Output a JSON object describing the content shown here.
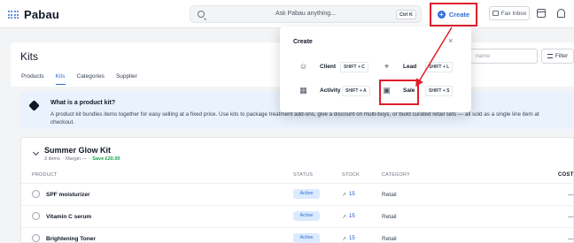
{
  "brand": {
    "name": "Pabau",
    "accent": "#2f6fd8",
    "highlight": "#e11d2a"
  },
  "search": {
    "placeholder": "Ask Pabau anything...",
    "shortcut": "Ctrl K"
  },
  "header": {
    "create_label": "Create",
    "fax_label": "Fax Inbox",
    "icons": [
      "calendar-icon",
      "bell-icon"
    ]
  },
  "page": {
    "title": "Kits",
    "tabs": [
      {
        "label": "Products",
        "active": false
      },
      {
        "label": "Kits",
        "active": true
      },
      {
        "label": "Categories",
        "active": false
      },
      {
        "label": "Supplier",
        "active": false
      }
    ],
    "name_placeholder": "name",
    "filter_label": "Filter"
  },
  "info": {
    "title": "What is a product kit?",
    "text": "A product kit bundles items together for easy selling at a fixed price. Use kits to package treatment add-ons, give a discount on multi-buys, or build curated retail sets — all sold as a single line item at checkout."
  },
  "kit": {
    "title": "Summer Glow Kit",
    "items": "3 items",
    "margin": "· Margin — ·",
    "save": "Save £20.00",
    "columns": {
      "product": "PRODUCT",
      "status": "STATUS",
      "stock": "STOCK",
      "category": "CATEGORY",
      "cost": "COST"
    },
    "rows": [
      {
        "name": "SPF moisturizer",
        "status": "Active",
        "stock": "15",
        "category": "Retail",
        "cost": "—"
      },
      {
        "name": "Vitamin C serum",
        "status": "Active",
        "stock": "15",
        "category": "Retail",
        "cost": "—"
      },
      {
        "name": "Brightening Toner",
        "status": "Active",
        "stock": "15",
        "category": "Retail",
        "cost": "—"
      }
    ]
  },
  "create_menu": {
    "title": "Create",
    "close": "×",
    "items": [
      {
        "label": "Client",
        "shortcut": "SHIFT + C",
        "icon": "user-icon"
      },
      {
        "label": "Lead",
        "shortcut": "SHIFT + L",
        "icon": "target-icon"
      },
      {
        "label": "Activity",
        "shortcut": "SHIFT + A",
        "icon": "calendar-icon"
      },
      {
        "label": "Sale",
        "shortcut": "SHIFT + S",
        "icon": "sale-icon"
      }
    ]
  }
}
